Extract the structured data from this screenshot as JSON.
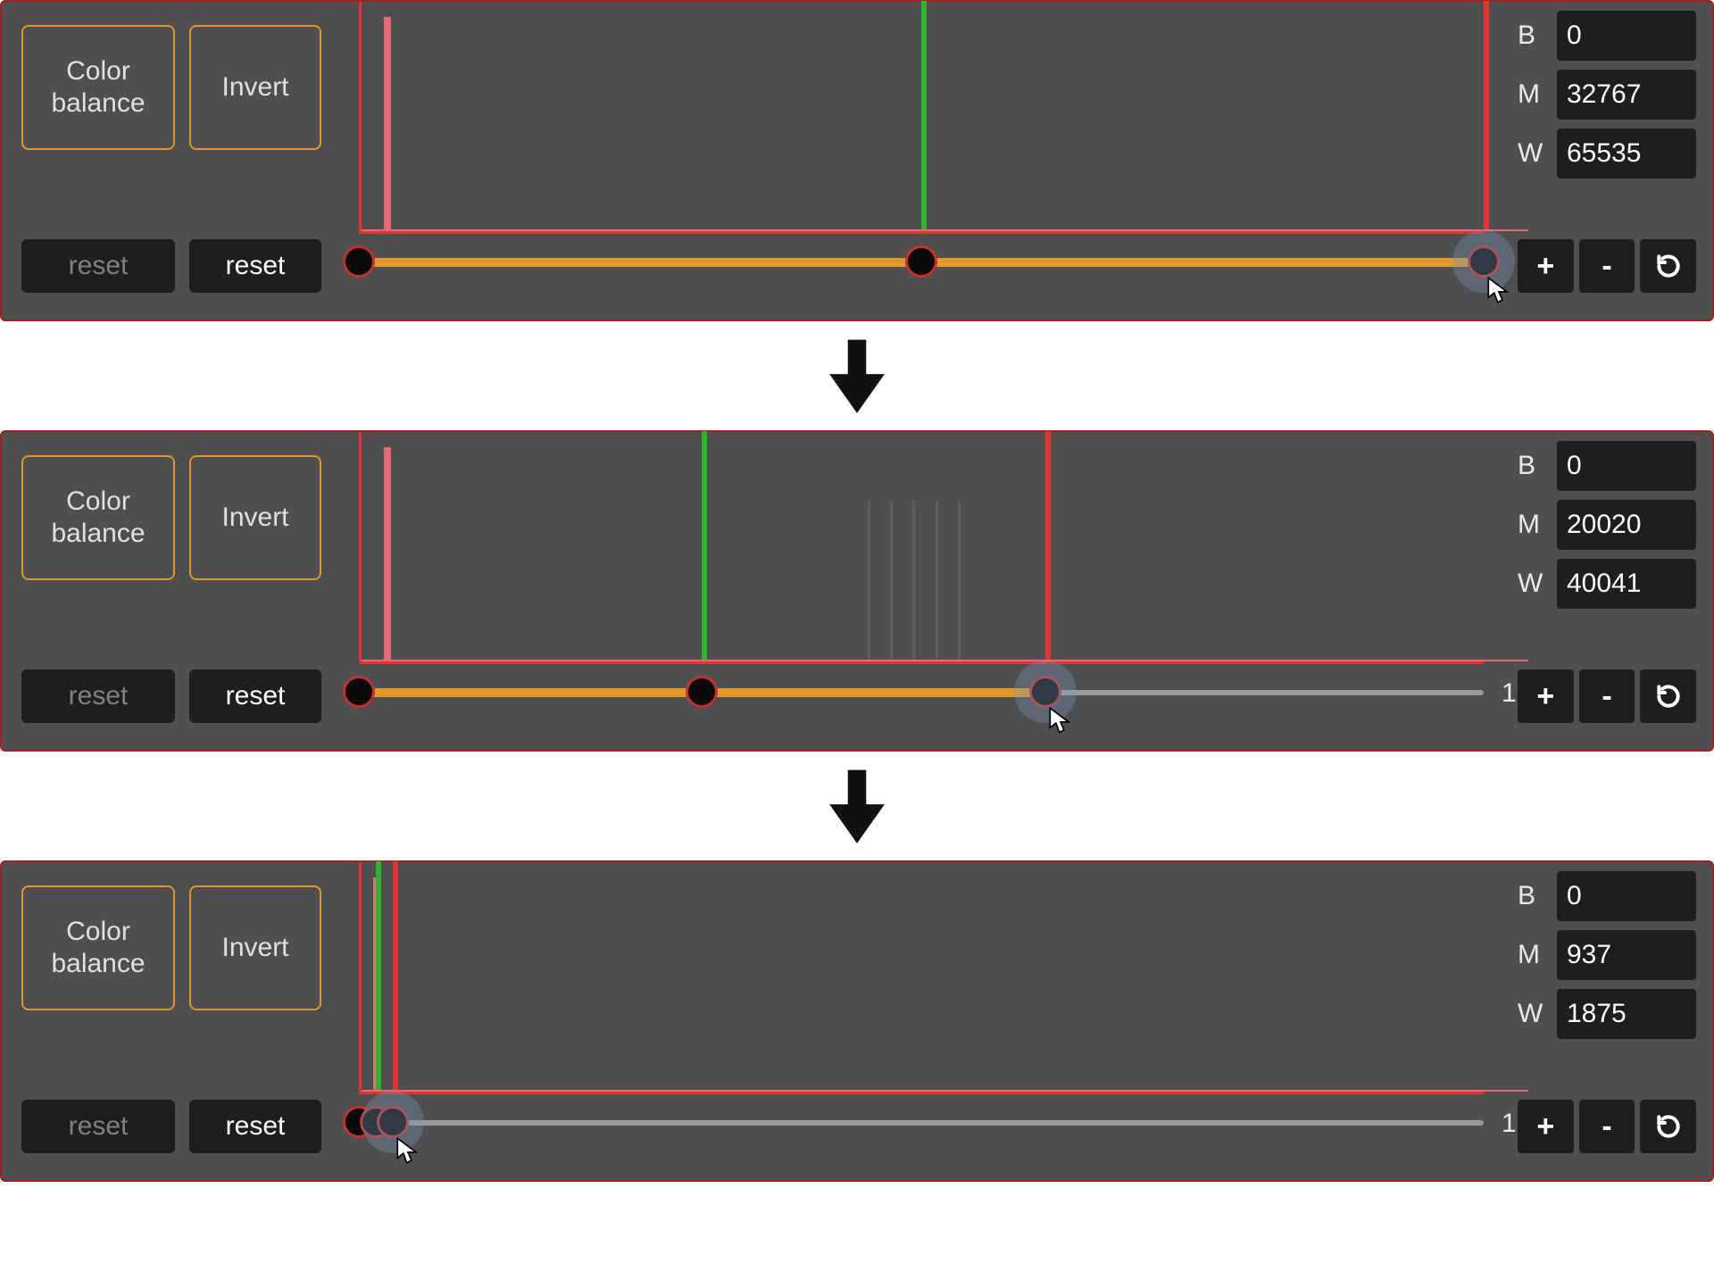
{
  "panels": [
    {
      "buttons": {
        "color_balance": "Color\nbalance",
        "invert": "Invert",
        "reset_muted": "reset",
        "reset": "reset"
      },
      "fields": {
        "b_label": "B",
        "b_value": "0",
        "m_label": "M",
        "m_value": "32767",
        "w_label": "W",
        "w_value": "65535"
      },
      "slider": {
        "end_label": "",
        "fill_percent": 100,
        "handles": [
          0,
          50,
          100
        ],
        "focus_index": 2,
        "cursor_at": 100
      },
      "histogram": {
        "peak_left_pct": 2,
        "green_pct": 50,
        "red_pct": 100,
        "baseline_extend": true
      },
      "mini": {
        "plus": "+",
        "minus": "-"
      }
    },
    {
      "buttons": {
        "color_balance": "Color\nbalance",
        "invert": "Invert",
        "reset_muted": "reset",
        "reset": "reset"
      },
      "fields": {
        "b_label": "B",
        "b_value": "0",
        "m_label": "M",
        "m_value": "20020",
        "w_label": "W",
        "w_value": "40041"
      },
      "slider": {
        "end_label": "1",
        "fill_percent": 61,
        "handles": [
          0,
          30.5,
          61
        ],
        "focus_index": 2,
        "cursor_at": 61
      },
      "histogram": {
        "peak_left_pct": 2,
        "green_pct": 30.5,
        "red_pct": 61,
        "baseline_extend": true,
        "faint_lines": [
          45,
          47,
          49,
          51,
          53
        ]
      },
      "mini": {
        "plus": "+",
        "minus": "-"
      }
    },
    {
      "buttons": {
        "color_balance": "Color\nbalance",
        "invert": "Invert",
        "reset_muted": "reset",
        "reset": "reset"
      },
      "fields": {
        "b_label": "B",
        "b_value": "0",
        "m_label": "M",
        "m_value": "937",
        "w_label": "W",
        "w_value": "1875"
      },
      "slider": {
        "end_label": "1",
        "fill_percent": 3,
        "handles": [
          0,
          1.5,
          3
        ],
        "focus_index": 2,
        "cursor_at": 3
      },
      "histogram": {
        "peak_left_pct": 1,
        "green_pct": 1.5,
        "red_pct": 3,
        "baseline_extend": true
      },
      "mini": {
        "plus": "+",
        "minus": "-"
      }
    }
  ]
}
